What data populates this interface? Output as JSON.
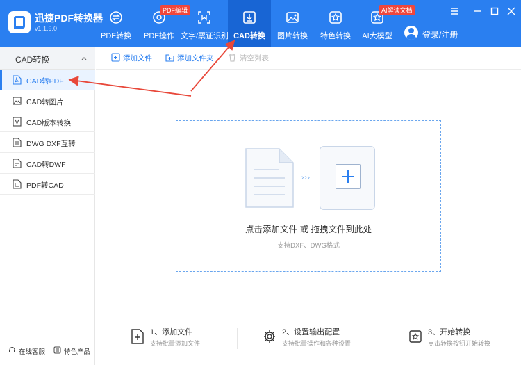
{
  "app": {
    "name": "迅捷PDF转换器",
    "version": "v1.1.9.0"
  },
  "nav": {
    "tabs": [
      {
        "label": "PDF转换",
        "icon": "pdf-convert-icon"
      },
      {
        "label": "PDF操作",
        "icon": "pdf-operate-icon",
        "badge": "PDF编辑"
      },
      {
        "label": "文字/票证识别",
        "icon": "ocr-icon"
      },
      {
        "label": "CAD转换",
        "icon": "cad-convert-icon",
        "active": true
      },
      {
        "label": "图片转换",
        "icon": "image-convert-icon"
      },
      {
        "label": "特色转换",
        "icon": "special-convert-icon"
      },
      {
        "label": "AI大模型",
        "icon": "ai-model-icon",
        "badge": "AI解读文档"
      }
    ],
    "login": "登录/注册"
  },
  "sidebar": {
    "title": "CAD转换",
    "items": [
      {
        "label": "CAD转PDF",
        "icon": "pdf-file-icon",
        "active": true
      },
      {
        "label": "CAD转图片",
        "icon": "image-file-icon"
      },
      {
        "label": "CAD版本转换",
        "icon": "version-icon"
      },
      {
        "label": "DWG DXF互转",
        "icon": "dwg-file-icon"
      },
      {
        "label": "CAD转DWF",
        "icon": "dwf-file-icon"
      },
      {
        "label": "PDF转CAD",
        "icon": "cad-file-icon"
      }
    ],
    "footer": {
      "support": "在线客服",
      "features": "特色产品"
    }
  },
  "toolbar": {
    "add_file": "添加文件",
    "add_folder": "添加文件夹",
    "clear_list": "清空列表"
  },
  "dropzone": {
    "main_text": "点击添加文件 或 拖拽文件到此处",
    "sub_text": "支持DXF、DWG格式"
  },
  "steps": [
    {
      "title": "1、添加文件",
      "desc": "支持批量添加文件",
      "icon": "add-file-icon"
    },
    {
      "title": "2、设置输出配置",
      "desc": "支持批量操作和各种设置",
      "icon": "settings-gear-icon"
    },
    {
      "title": "3、开始转换",
      "desc": "点击转换按钮开始转换",
      "icon": "convert-icon"
    }
  ],
  "colors": {
    "primary": "#2a7ff0",
    "active_tab": "#1865d4",
    "badge": "#f0463c",
    "annotation": "#e8483a"
  }
}
